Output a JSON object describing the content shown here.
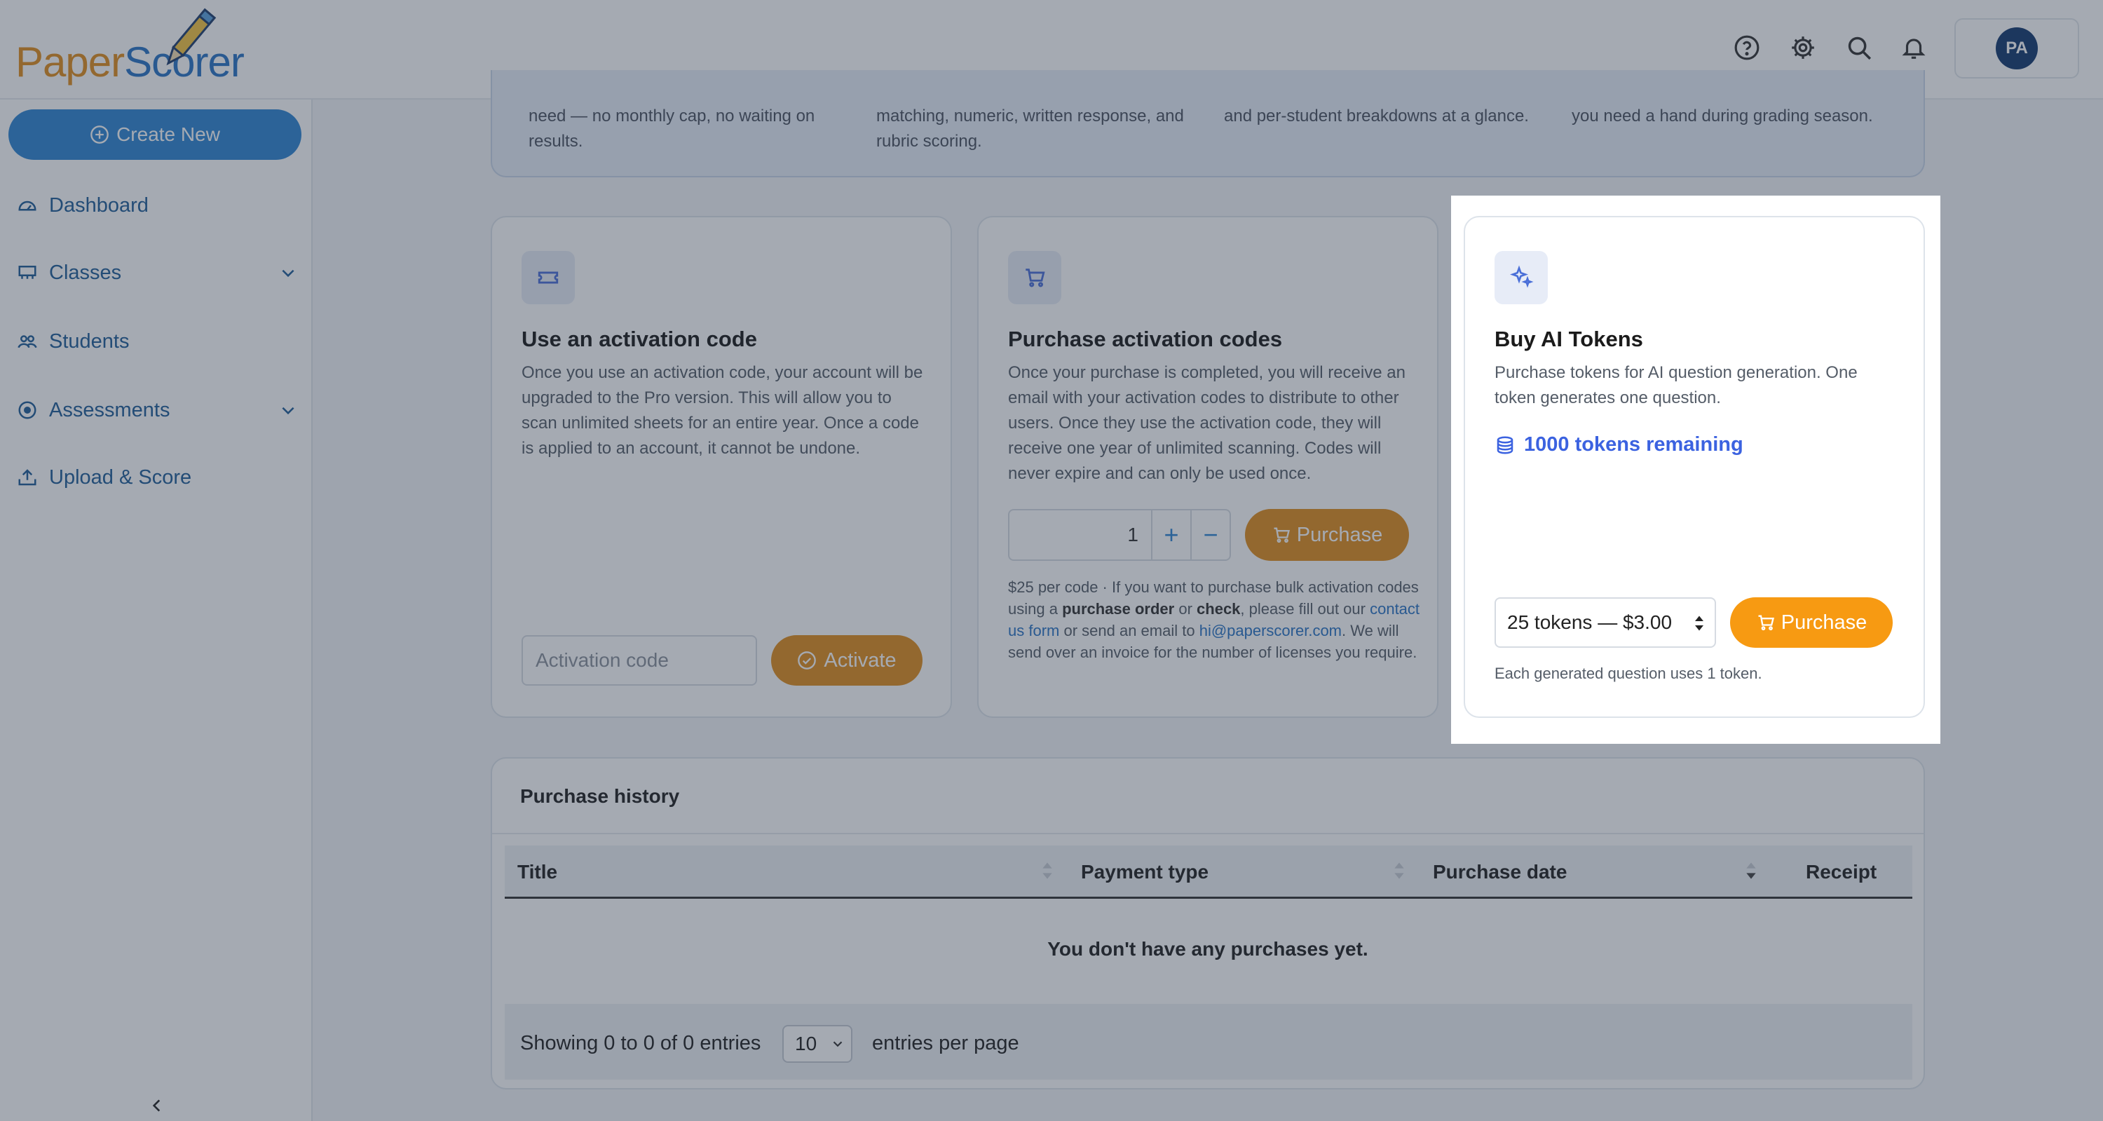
{
  "header": {
    "logo_part1": "Paper",
    "logo_part2": "Scorer",
    "avatar_initials": "PA"
  },
  "sidebar": {
    "create_label": "Create New",
    "items": [
      {
        "label": "Dashboard"
      },
      {
        "label": "Classes"
      },
      {
        "label": "Students"
      },
      {
        "label": "Assessments"
      },
      {
        "label": "Upload & Score"
      }
    ]
  },
  "banner": {
    "col1_line1": "need — no monthly cap, no waiting on",
    "col1_line2": "results.",
    "col2_line1": "matching, numeric, written response, and",
    "col2_line2": "rubric scoring.",
    "col3_line1": "and per-student breakdowns at a glance.",
    "col4_line1": "you need a hand during grading season."
  },
  "activation_card": {
    "title": "Use an activation code",
    "description": "Once you use an activation code, your account will be upgraded to the Pro version. This will allow you to scan unlimited sheets for an entire year. Once a code is applied to an account, it cannot be undone.",
    "input_placeholder": "Activation code",
    "button_label": "Activate"
  },
  "purchase_card": {
    "title": "Purchase activation codes",
    "description": "Once your purchase is completed, you will receive an email with your activation codes to distribute to other users. Once they use the activation code, they will receive one year of unlimited scanning. Codes will never expire and can only be used once.",
    "quantity": "1",
    "plus": "+",
    "minus": "−",
    "button_label": "Purchase",
    "fine_1": "$25 per code · If you want to purchase bulk activation codes using a ",
    "fine_b1": "purchase order",
    "fine_2": " or ",
    "fine_b2": "check",
    "fine_3": ", please fill out our ",
    "fine_link1": "contact us form",
    "fine_4": " or send an email to ",
    "fine_link2": "hi@paperscorer.com",
    "fine_5": ". We will send over an invoice for the number of licenses you require."
  },
  "tokens_card": {
    "title": "Buy AI Tokens",
    "description": "Purchase tokens for AI question generation. One token generates one question.",
    "remaining": "1000 tokens remaining",
    "selected_option": "25 tokens — $3.00",
    "button_label": "Purchase",
    "note": "Each generated question uses 1 token."
  },
  "history": {
    "title": "Purchase history",
    "columns": [
      "Title",
      "Payment type",
      "Purchase date",
      "Receipt"
    ],
    "empty_message": "You don't have any purchases yet.",
    "showing": "Showing 0 to 0 of 0 entries",
    "per_page_value": "10",
    "per_page_label": "entries per page"
  },
  "colors": {
    "brand_orange": "#e08e1e",
    "brand_blue": "#2f86d3",
    "token_blue": "#3b62e0",
    "avatar": "#14396e"
  }
}
